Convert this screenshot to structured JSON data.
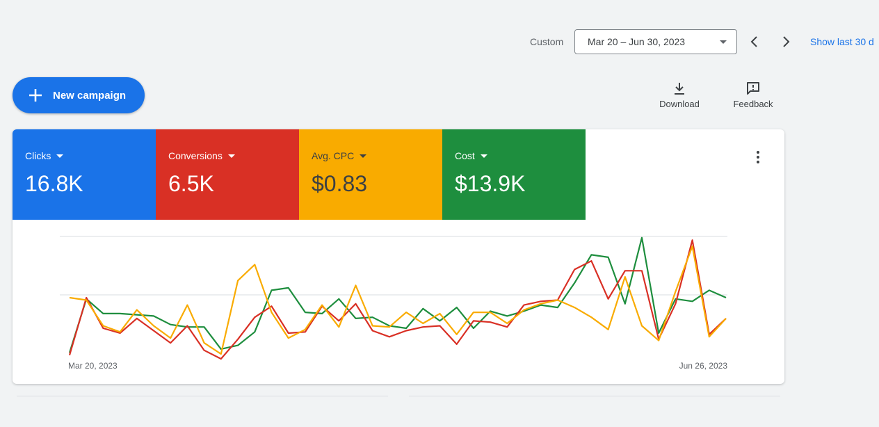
{
  "toolbar": {
    "custom_label": "Custom",
    "date_range": "Mar 20 – Jun 30, 2023",
    "show_last": "Show last 30 d"
  },
  "new_campaign_label": "New campaign",
  "tools": {
    "download": "Download",
    "feedback": "Feedback"
  },
  "metrics": [
    {
      "label": "Clicks",
      "value": "16.8K",
      "color": "#1a73e8",
      "text_color": "#ffffff"
    },
    {
      "label": "Conversions",
      "value": "6.5K",
      "color": "#d93025",
      "text_color": "#ffffff"
    },
    {
      "label": "Avg. CPC",
      "value": "$0.83",
      "color": "#f9ab00",
      "text_color": "#3c4043"
    },
    {
      "label": "Cost",
      "value": "$13.9K",
      "color": "#1e8e3e",
      "text_color": "#ffffff"
    }
  ],
  "chart_data": {
    "type": "line",
    "x_start_label": "Mar 20, 2023",
    "x_end_label": "Jun 26, 2023",
    "ylim": [
      0,
      100
    ],
    "grid": "horizontal",
    "series": [
      {
        "color": "#1e8e3e",
        "values": [
          5,
          49,
          37,
          37,
          36,
          35,
          28,
          26,
          26,
          8,
          11,
          22,
          56,
          58,
          38,
          37,
          49,
          33,
          34,
          27,
          25,
          41,
          31,
          42,
          25,
          39,
          35,
          39,
          44,
          42,
          62,
          85,
          83,
          45,
          99,
          21,
          49,
          47,
          56,
          50
        ]
      },
      {
        "color": "#d93025",
        "values": [
          3,
          50,
          25,
          21,
          33,
          23,
          13,
          27,
          7,
          0,
          16,
          34,
          43,
          21,
          22,
          43,
          31,
          45,
          23,
          18,
          23,
          26,
          27,
          12,
          31,
          30,
          26,
          44,
          47,
          48,
          73,
          80,
          49,
          72,
          72,
          16,
          45,
          97,
          20,
          33
        ]
      },
      {
        "color": "#f9ab00",
        "values": [
          50,
          48,
          27,
          22,
          40,
          27,
          17,
          44,
          13,
          4,
          64,
          77,
          38,
          17,
          24,
          44,
          26,
          60,
          27,
          26,
          38,
          29,
          37,
          20,
          38,
          38,
          29,
          40,
          45,
          48,
          42,
          34,
          24,
          67,
          27,
          15,
          55,
          92,
          18,
          33
        ]
      }
    ]
  }
}
